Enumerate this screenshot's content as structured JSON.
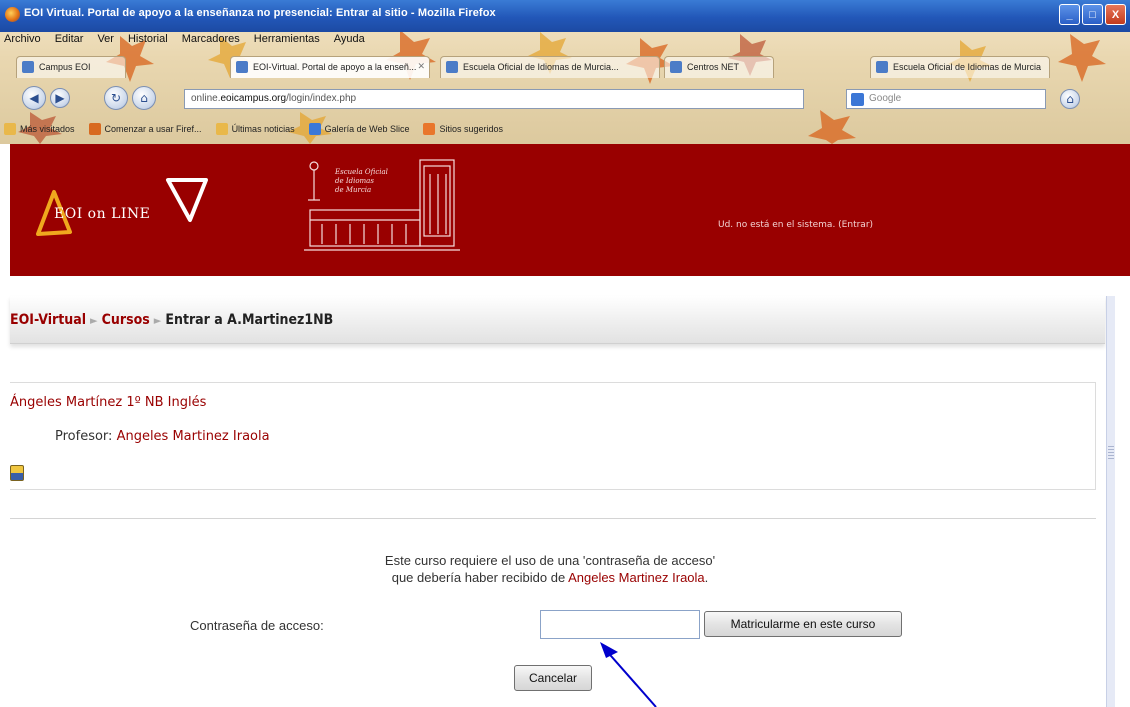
{
  "browser": {
    "title": "EOI Virtual. Portal de apoyo a la enseñanza no presencial: Entrar al sitio - Mozilla Firefox",
    "window_buttons": [
      "_",
      "□",
      "X"
    ],
    "menu": [
      "Archivo",
      "Editar",
      "Ver",
      "Historial",
      "Marcadores",
      "Herramientas",
      "Ayuda"
    ],
    "tabs": [
      {
        "label": "Campus EOI"
      },
      {
        "label": "EOI-Virtual. Portal de apoyo a la enseñ..."
      },
      {
        "label": "Escuela Oficial de Idiomas de Murcia..."
      },
      {
        "label": "Centros NET"
      },
      {
        "label": "Escuela Oficial de Idiomas de Murcia"
      }
    ],
    "address": {
      "prefix": "online.",
      "domain": "eoicampus.org",
      "path": "/login/index.php"
    },
    "search_placeholder": "Google",
    "bookmarks": [
      "Más visitados",
      "Comenzar a usar Firef...",
      "Últimas noticias",
      "Galería de Web Slice",
      "Sitios sugeridos"
    ]
  },
  "header": {
    "logo": "EOI on LINE",
    "crest_text": [
      "Escuela Oficial",
      "de Idiomas",
      "de Murcia"
    ],
    "login_status": "Ud. no está en el sistema. (Entrar)"
  },
  "breadcrumb": {
    "home": "EOI-Virtual",
    "courses": "Cursos",
    "current": "Entrar a A.Martinez1NB",
    "separator": "►"
  },
  "course": {
    "name": "Ángeles Martínez 1º NB Inglés",
    "teacher_label": "Profesor: ",
    "teacher_name": "Angeles Martinez Iraola"
  },
  "enrol": {
    "message_line1": "Este curso requiere el uso de una 'contraseña de acceso'",
    "message_line2": "que debería haber recibido de ",
    "message_name": "Angeles Martinez Iraola",
    "message_end": ".",
    "password_label": "Contraseña de acceso:",
    "password_value": "",
    "enrol_button": "Matricularme en este curso",
    "cancel_button": "Cancelar"
  },
  "colors": {
    "brand": "#990000",
    "titlebar": "#2257b8",
    "arrow": "#0000cc"
  }
}
